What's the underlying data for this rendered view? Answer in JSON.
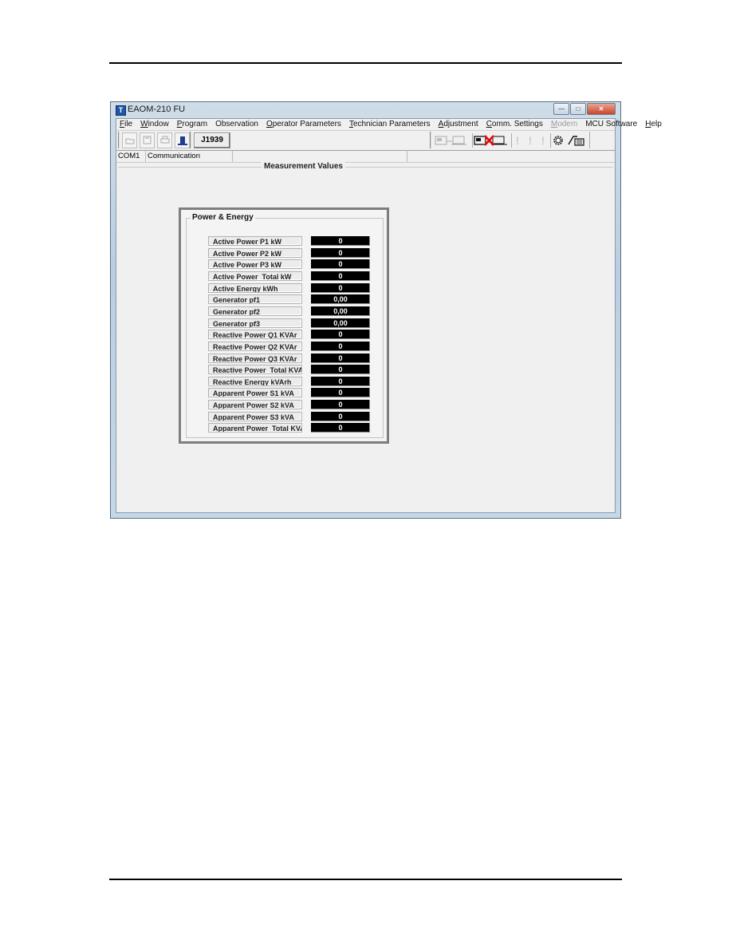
{
  "window": {
    "title": "EAOM-210 FU",
    "buttons": {
      "minimize": "minimize-icon",
      "maximize": "maximize-icon",
      "close": "close-icon"
    }
  },
  "menu": [
    {
      "label": "File",
      "accel": "F",
      "rest": "ile",
      "disabled": false
    },
    {
      "label": "Window",
      "accel": "W",
      "rest": "indow",
      "disabled": false
    },
    {
      "label": "Program",
      "accel": "P",
      "rest": "rogram",
      "disabled": false
    },
    {
      "label": "Observation",
      "accel": "",
      "rest": "Observation",
      "disabled": false
    },
    {
      "label": "Operator Parameters",
      "accel": "O",
      "rest": "perator Parameters",
      "disabled": false
    },
    {
      "label": "Technician Parameters",
      "accel": "T",
      "rest": "echnician Parameters",
      "disabled": false
    },
    {
      "label": "Adjustment",
      "accel": "A",
      "rest": "djustment",
      "disabled": false
    },
    {
      "label": "Comm. Settings",
      "accel": "C",
      "rest": "omm. Settings",
      "disabled": false
    },
    {
      "label": "Modem",
      "accel": "M",
      "rest": "odem",
      "disabled": true
    },
    {
      "label": "MCU Software",
      "accel": "",
      "rest": "MCU Software",
      "disabled": false
    },
    {
      "label": "Help",
      "accel": "H",
      "rest": "elp",
      "disabled": false
    }
  ],
  "toolbar": {
    "left_icons": [
      "open-folder-icon",
      "save-disk-icon",
      "print-icon",
      "exit-door-icon"
    ],
    "j1939_label": "J1939",
    "right_icons": [
      "connect-icon",
      "disconnect-icon",
      "alarm-icon-1",
      "alarm-icon-2",
      "alarm-icon-3",
      "gear-icon",
      "modem-phone-icon"
    ]
  },
  "statusbar": {
    "port": "COM1",
    "state": "Communication",
    "field3": "",
    "field4": ""
  },
  "section_title": "Measurement Values",
  "group": {
    "title": "Power & Energy",
    "rows": [
      {
        "label": "Active Power P1 kW",
        "value": "0"
      },
      {
        "label": "Active Power P2 kW",
        "value": "0"
      },
      {
        "label": "Active Power P3 kW",
        "value": "0"
      },
      {
        "label": "Active Power  Total kW",
        "value": "0"
      },
      {
        "label": "Active Energy kWh",
        "value": "0"
      },
      {
        "label": "Generator pf1",
        "value": "0,00"
      },
      {
        "label": "Generator pf2",
        "value": "0,00"
      },
      {
        "label": "Generator pf3",
        "value": "0,00"
      },
      {
        "label": "Reactive Power Q1 KVAr",
        "value": "0"
      },
      {
        "label": "Reactive Power Q2 KVAr",
        "value": "0"
      },
      {
        "label": "Reactive Power Q3 KVAr",
        "value": "0"
      },
      {
        "label": "Reactive Power  Total KVAr",
        "value": "0"
      },
      {
        "label": "Reactive Energy kVArh",
        "value": "0"
      },
      {
        "label": "Apparent Power S1 kVA",
        "value": "0"
      },
      {
        "label": "Apparent Power S2 kVA",
        "value": "0"
      },
      {
        "label": "Apparent Power S3 kVA",
        "value": "0"
      },
      {
        "label": "Apparent Power  Total KVA",
        "value": "0"
      }
    ]
  }
}
